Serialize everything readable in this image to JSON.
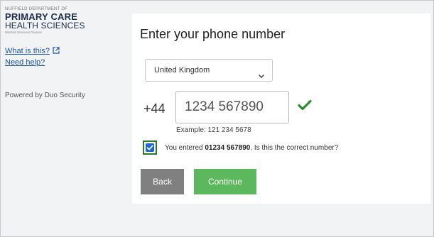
{
  "sidebar": {
    "logo": {
      "line1": "NUFFIELD DEPARTMENT OF",
      "line2": "PRIMARY CARE",
      "line3": "HEALTH SCIENCES",
      "line4": "Medical Sciences Division"
    },
    "what_is_this": "What is this?",
    "need_help": "Need help?",
    "powered_by": "Powered by Duo Security"
  },
  "main": {
    "title": "Enter your phone number",
    "country": "United Kingdom",
    "country_code": "+44",
    "phone_value": "1234 567890",
    "example": "Example: 121 234 5678",
    "confirm_prefix": "You entered ",
    "confirm_number": "01234 567890",
    "confirm_suffix": ". Is this the correct number?",
    "back_label": "Back",
    "continue_label": "Continue"
  },
  "colors": {
    "continue": "#5cb85c",
    "back": "#808080",
    "check": "#2e8b2e",
    "checkbox": "#1a66d4",
    "link": "#1a56a8"
  }
}
